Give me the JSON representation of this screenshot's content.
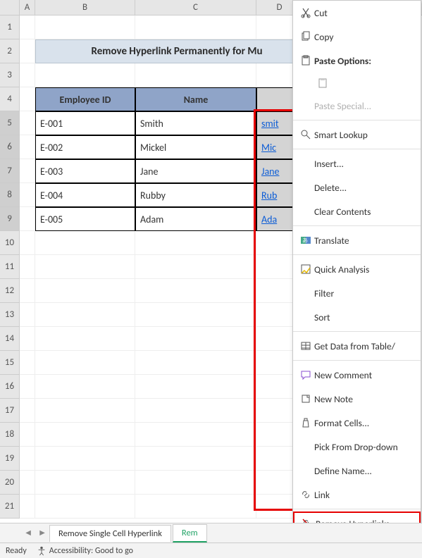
{
  "columns": [
    "A",
    "B",
    "C",
    "D"
  ],
  "rows": [
    "1",
    "2",
    "3",
    "4",
    "5",
    "6",
    "7",
    "8",
    "9",
    "10",
    "11",
    "12",
    "13",
    "14",
    "15",
    "16",
    "17",
    "18",
    "19",
    "20",
    "21"
  ],
  "title": "Remove Hyperlink Permanently for Mu",
  "headers": {
    "b": "Employee ID",
    "c": "Name"
  },
  "data": [
    {
      "id": "E-001",
      "name": "Smith",
      "link": "smit"
    },
    {
      "id": "E-002",
      "name": "Mickel",
      "link": "Mic"
    },
    {
      "id": "E-003",
      "name": "Jane",
      "link": "Jane"
    },
    {
      "id": "E-004",
      "name": "Rubby",
      "link": "Rub"
    },
    {
      "id": "E-005",
      "name": "Adam",
      "link": "Ada"
    }
  ],
  "ctx": {
    "cut": "Cut",
    "copy": "Copy",
    "pasteopts": "Paste Options:",
    "pastespecial": "Paste Special...",
    "smartlookup": "Smart Lookup",
    "insert": "Insert...",
    "delete": "Delete...",
    "clear": "Clear Contents",
    "translate": "Translate",
    "quick": "Quick Analysis",
    "filter": "Filter",
    "sort": "Sort",
    "getdata": "Get Data from Table/",
    "newcomment": "New Comment",
    "newnote": "New Note",
    "format": "Format Cells...",
    "pick": "Pick From Drop-down",
    "define": "Define Name...",
    "link": "Link",
    "remove": "Remove Hyperlinks"
  },
  "tabs": {
    "t1": "Remove Single Cell Hyperlink",
    "t2": "Rem"
  },
  "status": {
    "ready": "Ready",
    "acc": "Accessibility: Good to go"
  }
}
